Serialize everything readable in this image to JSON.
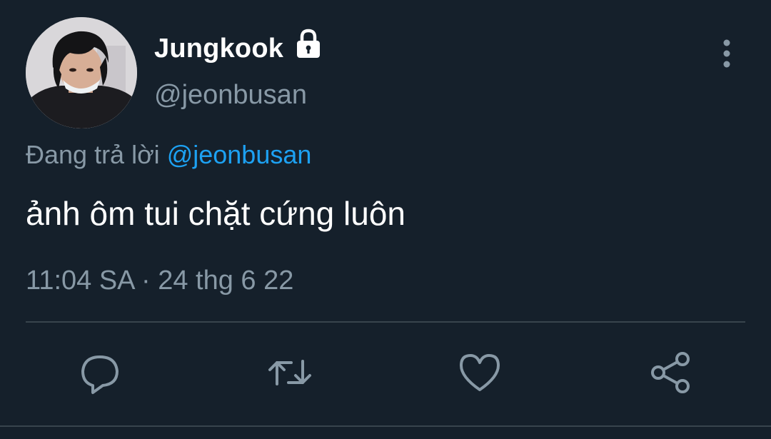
{
  "user": {
    "display_name": "Jungkook",
    "handle": "@jeonbusan",
    "protected_icon": "lock-icon"
  },
  "reply": {
    "prefix": "Đang trả lời",
    "mention": "@jeonbusan"
  },
  "tweet": {
    "text": "ảnh ôm tui chặt cứng luôn",
    "timestamp": "11:04 SA · 24 thg 6 22"
  },
  "actions": [
    {
      "name": "reply",
      "icon": "speech-bubble-icon"
    },
    {
      "name": "retweet",
      "icon": "retweet-icon"
    },
    {
      "name": "like",
      "icon": "heart-icon"
    },
    {
      "name": "share",
      "icon": "share-icon"
    }
  ],
  "colors": {
    "background": "#15202b",
    "primary_text": "#ffffff",
    "secondary_text": "#8899a6",
    "accent": "#1da1f2",
    "divider": "#38444d"
  }
}
